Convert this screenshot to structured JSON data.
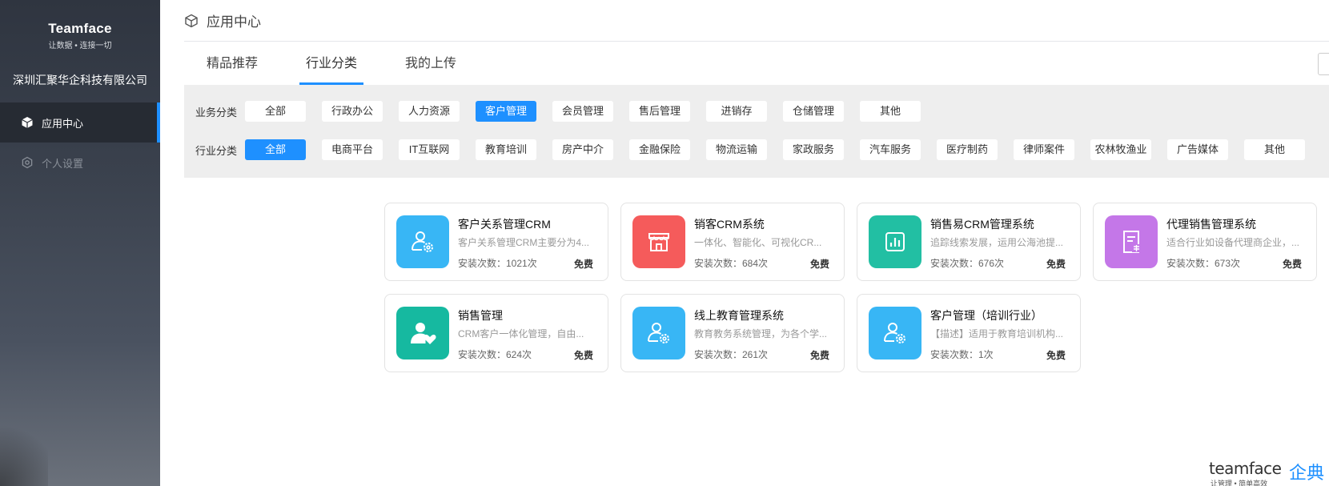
{
  "brand": {
    "name": "Teamface",
    "slogan": "让数据 • 连接一切"
  },
  "company": "深圳汇聚华企科技有限公司",
  "nav": [
    {
      "label": "应用中心",
      "icon": "cube-icon",
      "active": true
    },
    {
      "label": "个人设置",
      "icon": "gear-icon",
      "active": false
    }
  ],
  "header": {
    "title": "应用中心"
  },
  "tabs": [
    {
      "label": "精品推荐"
    },
    {
      "label": "行业分类",
      "active": true
    },
    {
      "label": "我的上传"
    }
  ],
  "filters": {
    "business": {
      "label": "业务分类",
      "selected": "客户管理",
      "options": [
        "全部",
        "行政办公",
        "人力资源",
        "客户管理",
        "会员管理",
        "售后管理",
        "进销存",
        "仓储管理",
        "其他"
      ]
    },
    "industry": {
      "label": "行业分类",
      "selected": "全部",
      "options": [
        "全部",
        "电商平台",
        "IT互联网",
        "教育培训",
        "房产中介",
        "金融保险",
        "物流运输",
        "家政服务",
        "汽车服务",
        "医疗制药",
        "律师案件",
        "农林牧渔业",
        "广告媒体",
        "其他"
      ]
    }
  },
  "apps": [
    {
      "title": "客户关系管理CRM",
      "desc": "客户关系管理CRM主要分为4...",
      "installs": "安装次数：1021次",
      "price": "免费",
      "icon": "user-gear-icon",
      "color": "#38b6f5"
    },
    {
      "title": "销客CRM系统",
      "desc": "一体化、智能化、可视化CR...",
      "installs": "安装次数：684次",
      "price": "免费",
      "icon": "store-icon",
      "color": "#f55b5b"
    },
    {
      "title": "销售易CRM管理系统",
      "desc": "追踪线索发展，运用公海池提...",
      "installs": "安装次数：676次",
      "price": "免费",
      "icon": "bar-chart-icon",
      "color": "#22bfa3"
    },
    {
      "title": "代理销售管理系统",
      "desc": "适合行业如设备代理商企业，...",
      "installs": "安装次数：673次",
      "price": "免费",
      "icon": "doc-sale-icon",
      "color": "#c477e8"
    },
    {
      "title": "销售管理",
      "desc": "CRM客户一体化管理，自由...",
      "installs": "安装次数：624次",
      "price": "免费",
      "icon": "user-heart-icon",
      "color": "#16b9a0"
    },
    {
      "title": "线上教育管理系统",
      "desc": "教育教务系统管理，为各个学...",
      "installs": "安装次数：261次",
      "price": "免费",
      "icon": "user-gear-icon",
      "color": "#38b6f5"
    },
    {
      "title": "客户管理（培训行业）",
      "desc": "【描述】适用于教育培训机构...",
      "installs": "安装次数：1次",
      "price": "免费",
      "icon": "user-gear-icon",
      "color": "#38b6f5"
    }
  ],
  "footer": {
    "en": "teamface",
    "sub": "让管理 • 简单高效",
    "cn": "企典"
  }
}
